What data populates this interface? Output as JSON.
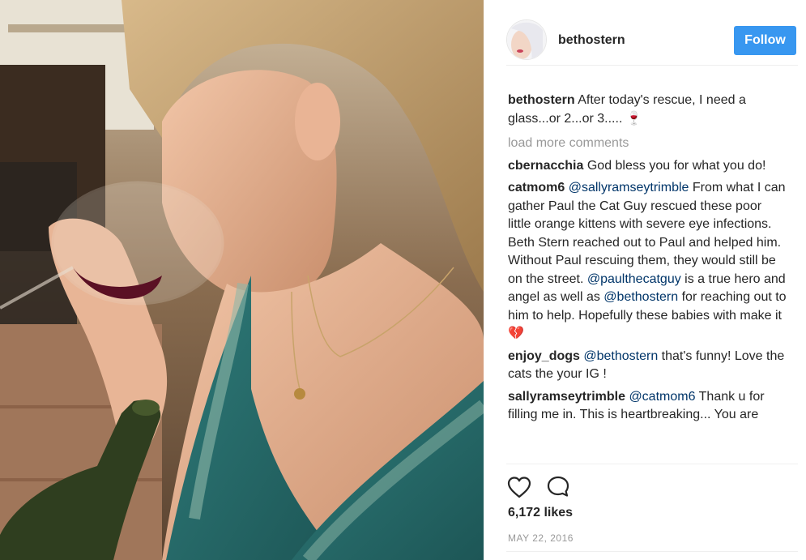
{
  "post": {
    "author": "bethostern",
    "follow_label": "Follow",
    "caption": "After today's rescue, I need a glass...or 2...or 3..... 🍷",
    "load_more": "load more comments",
    "comments": [
      {
        "user": "cbernacchia",
        "parts": [
          {
            "t": "God bless you for what you do!"
          }
        ]
      },
      {
        "user": "catmom6",
        "parts": [
          {
            "t": "@sallyramseytrimble",
            "m": true
          },
          {
            "t": " From what I can gather Paul the Cat Guy rescued these poor little orange kittens with severe eye infections. Beth Stern reached out to Paul and helped him. Without Paul rescuing them, they would still be on the street. "
          },
          {
            "t": "@paulthecatguy",
            "m": true
          },
          {
            "t": " is a true hero and angel as well as "
          },
          {
            "t": "@bethostern",
            "m": true
          },
          {
            "t": " for reaching out to him to help. Hopefully these babies with make it 💔"
          }
        ]
      },
      {
        "user": "enjoy_dogs",
        "parts": [
          {
            "t": "@bethostern",
            "m": true
          },
          {
            "t": " that's funny! Love the cats the your IG !"
          }
        ]
      },
      {
        "user": "sallyramseytrimble",
        "parts": [
          {
            "t": "@catmom6",
            "m": true
          },
          {
            "t": " Thank u for filling me in. This is heartbreaking... You are"
          }
        ]
      }
    ],
    "likes": "6,172 likes",
    "date": "MAY 22, 2016",
    "icons": {
      "like": "heart-icon",
      "comment": "speech-bubble-icon"
    },
    "colors": {
      "follow_bg": "#3897f0",
      "mention": "#003569",
      "muted": "#999999"
    }
  }
}
